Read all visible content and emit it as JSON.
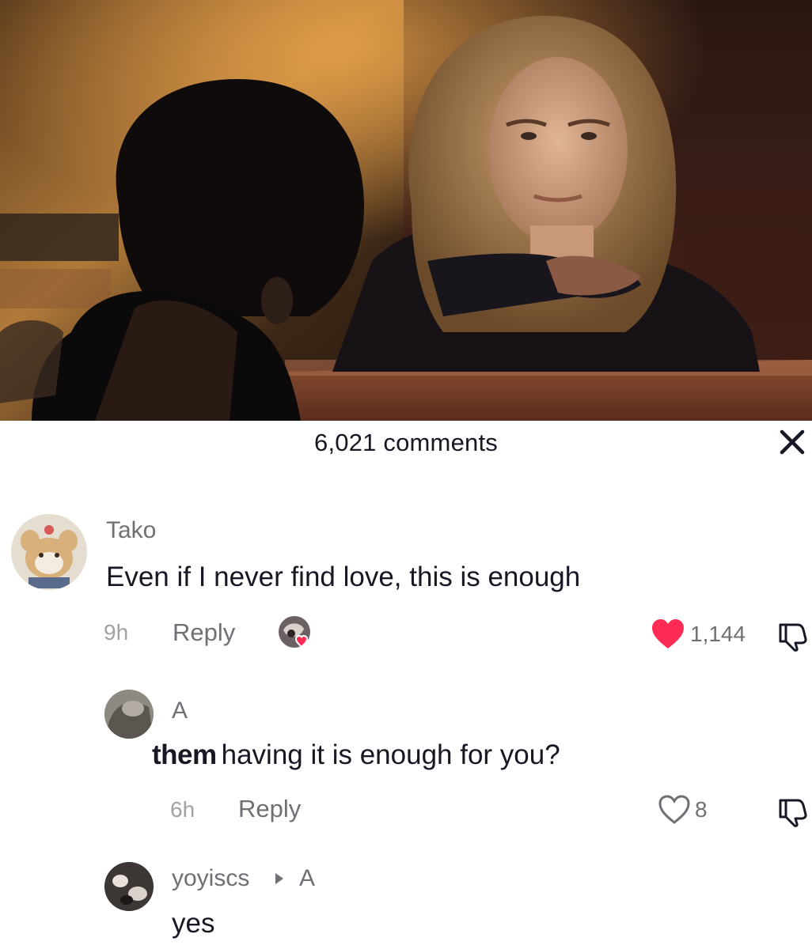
{
  "sheet": {
    "comment_count": "6,021 comments",
    "close_icon": "close-icon"
  },
  "comments": [
    {
      "username": "Tako",
      "text": "Even if I never find love, this is enough",
      "time": "9h",
      "reply_label": "Reply",
      "likes": "1,144",
      "liked": true,
      "creator_liked": true
    },
    {
      "username": "A",
      "text_strong": "them",
      "text": "having it is enough for you?",
      "time": "6h",
      "reply_label": "Reply",
      "likes": "8",
      "liked": false
    },
    {
      "username": "yoyiscs",
      "reply_to": "A",
      "text": "yes"
    }
  ],
  "colors": {
    "like_red": "#fe2c55",
    "text": "#161823",
    "muted": "#6f6f75"
  }
}
